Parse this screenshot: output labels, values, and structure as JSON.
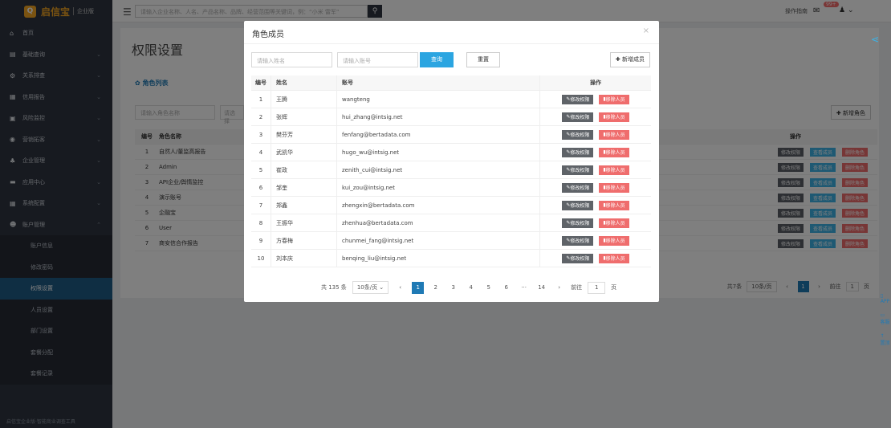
{
  "topbar": {
    "brand": "启信宝",
    "brand_tag": "企业版",
    "search_placeholder": "请输入企业名称、人名、产品名称、品牌、经营范围等关键词，例：“小米 雷军”",
    "guide": "操作指南",
    "msg_badge": "99+"
  },
  "sidebar": {
    "items": [
      {
        "icon": "home-icon",
        "glyph": "⌂",
        "label": "首页"
      },
      {
        "icon": "query-icon",
        "glyph": "▤",
        "label": "基础查询"
      },
      {
        "icon": "relation-icon",
        "glyph": "⚙",
        "label": "关系排查"
      },
      {
        "icon": "report-icon",
        "glyph": "▦",
        "label": "信用报告"
      },
      {
        "icon": "monitor-icon",
        "glyph": "▣",
        "label": "风险监控"
      },
      {
        "icon": "marketing-icon",
        "glyph": "◉",
        "label": "营销拓客"
      },
      {
        "icon": "enterprise-icon",
        "glyph": "♣",
        "label": "企业管理"
      },
      {
        "icon": "app-icon",
        "glyph": "▬",
        "label": "应用中心"
      },
      {
        "icon": "config-icon",
        "glyph": "▦",
        "label": "系统配置"
      },
      {
        "icon": "account-icon",
        "glyph": "☻",
        "label": "账户管理"
      }
    ],
    "subitems": [
      "账户信息",
      "修改密码",
      "权限设置",
      "人员设置",
      "部门设置",
      "套餐分配",
      "套餐记录"
    ],
    "footer": "启信宝企业版·智能商业调查工具"
  },
  "main": {
    "title": "权限设置",
    "role_list": "角色列表",
    "role_search_placeholder": "请输入角色名称",
    "role_search_placeholder2": "请选择",
    "add_role": "新增角色",
    "table_head": {
      "no": "编号",
      "name": "角色名称",
      "ops": "操作"
    },
    "roles": [
      {
        "no": "1",
        "name": "自然人/董监高报告"
      },
      {
        "no": "2",
        "name": "Admin"
      },
      {
        "no": "3",
        "name": "API企业/舆情监控"
      },
      {
        "no": "4",
        "name": "演示账号"
      },
      {
        "no": "5",
        "name": "企融宝"
      },
      {
        "no": "6",
        "name": "User"
      },
      {
        "no": "7",
        "name": "商安信合作报告"
      }
    ],
    "role_ops": {
      "edit": "修改权限",
      "view": "查看成员",
      "delete": "删除角色"
    },
    "pager": {
      "total": "共7条",
      "size": "10条/页",
      "page": "1",
      "goto": "前往",
      "goto_val": "1",
      "unit": "页"
    }
  },
  "modal": {
    "title": "角色成员",
    "name_placeholder": "请输入姓名",
    "account_placeholder": "请输入账号",
    "query": "查询",
    "reset": "重置",
    "add_member": "新增成员",
    "head": {
      "no": "编号",
      "name": "姓名",
      "account": "账号",
      "ops": "操作"
    },
    "ops": {
      "edit": "修改权限",
      "remove": "移除人员"
    },
    "rows": [
      {
        "no": "1",
        "name": "王腾",
        "account": "wangteng"
      },
      {
        "no": "2",
        "name": "张辉",
        "account": "hui_zhang@intsig.net"
      },
      {
        "no": "3",
        "name": "樊芬芳",
        "account": "fenfang@bertadata.com"
      },
      {
        "no": "4",
        "name": "武凯华",
        "account": "hugo_wu@intsig.net"
      },
      {
        "no": "5",
        "name": "崔政",
        "account": "zenith_cui@intsig.net"
      },
      {
        "no": "6",
        "name": "邹奎",
        "account": "kui_zou@intsig.net"
      },
      {
        "no": "7",
        "name": "郑鑫",
        "account": "zhengxin@bertadata.com"
      },
      {
        "no": "8",
        "name": "王振华",
        "account": "zhenhua@bertadata.com"
      },
      {
        "no": "9",
        "name": "方春梅",
        "account": "chunmei_fang@intsig.net"
      },
      {
        "no": "10",
        "name": "刘本庆",
        "account": "benqing_liu@intsig.net"
      }
    ],
    "pager": {
      "total": "共 135 条",
      "size": "10条/页",
      "pages": [
        "1",
        "2",
        "3",
        "4",
        "5",
        "6",
        "···",
        "14"
      ],
      "goto": "前往",
      "goto_val": "1",
      "unit": "页"
    }
  },
  "dock": {
    "app": "APP",
    "service": "客服",
    "top": "置顶"
  }
}
